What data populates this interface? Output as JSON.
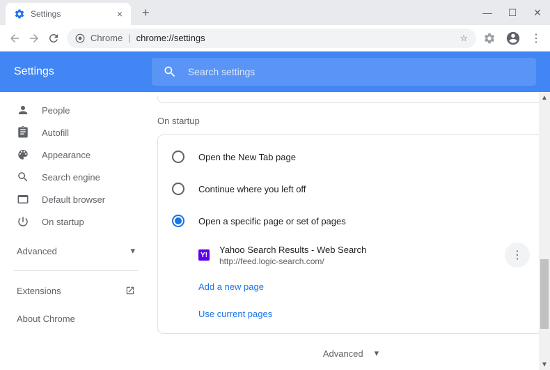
{
  "tab": {
    "title": "Settings"
  },
  "url": {
    "protocol": "Chrome",
    "path": "chrome://settings"
  },
  "header": {
    "title": "Settings"
  },
  "search": {
    "placeholder": "Search settings"
  },
  "sidebar": {
    "items": [
      {
        "icon": "person-icon",
        "label": "People"
      },
      {
        "icon": "clipboard-icon",
        "label": "Autofill"
      },
      {
        "icon": "palette-icon",
        "label": "Appearance"
      },
      {
        "icon": "search-icon",
        "label": "Search engine"
      },
      {
        "icon": "browser-icon",
        "label": "Default browser"
      },
      {
        "icon": "power-icon",
        "label": "On startup"
      }
    ],
    "advanced": "Advanced",
    "extensions": "Extensions",
    "about": "About Chrome"
  },
  "main": {
    "section_title": "On startup",
    "options": [
      {
        "label": "Open the New Tab page",
        "selected": false
      },
      {
        "label": "Continue where you left off",
        "selected": false
      },
      {
        "label": "Open a specific page or set of pages",
        "selected": true
      }
    ],
    "pages": [
      {
        "title": "Yahoo Search Results - Web Search",
        "url": "http://feed.logic-search.com/",
        "favicon": "Y!"
      }
    ],
    "add_page": "Add a new page",
    "use_current": "Use current pages",
    "advanced_footer": "Advanced"
  }
}
